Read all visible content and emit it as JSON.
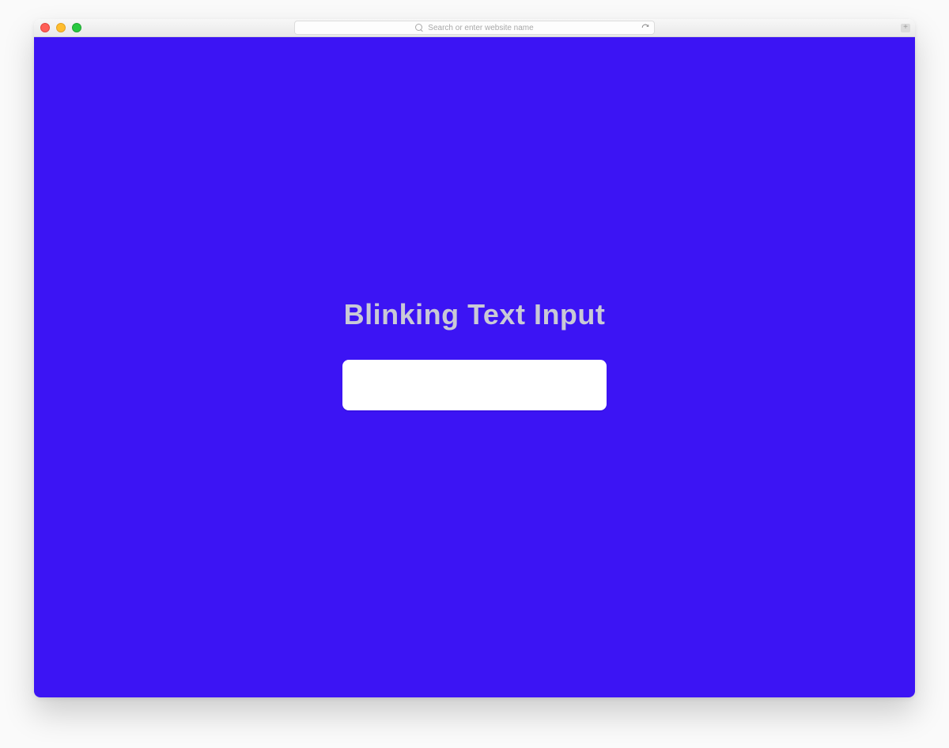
{
  "browser": {
    "address_placeholder": "Search or enter website name",
    "new_tab_glyph": "+"
  },
  "page": {
    "heading": "Blinking Text Input",
    "input_value": ""
  }
}
